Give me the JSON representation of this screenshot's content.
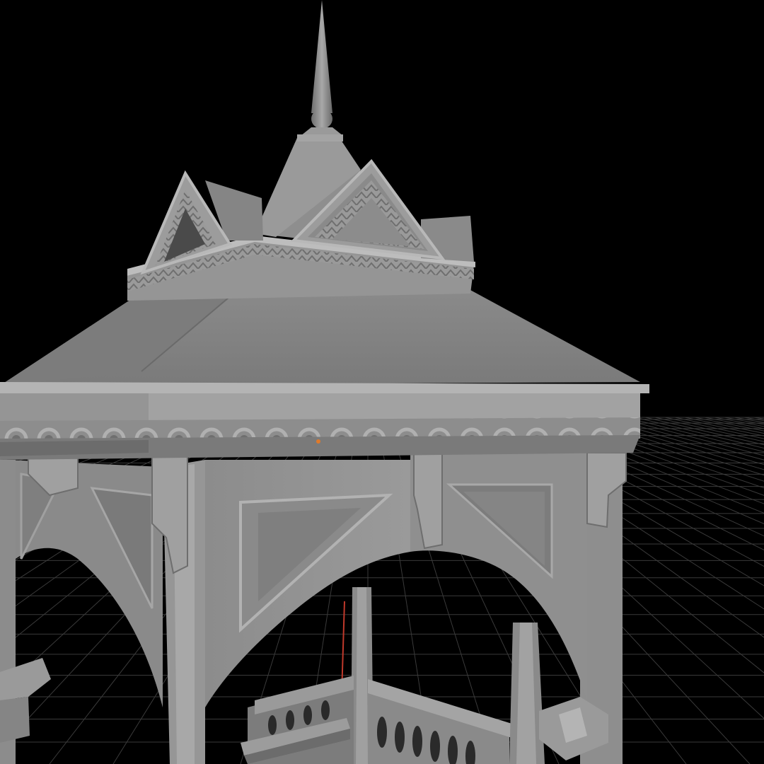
{
  "viewport": {
    "background_color": "#000000",
    "grid_color": "#3a3a3a",
    "model_color": "#8e8e8e",
    "origin_marker_color": "#e07a2a",
    "axis_line_color": "#c0392b"
  },
  "model": {
    "subject": "gazebo",
    "shading": "solid-gray"
  }
}
